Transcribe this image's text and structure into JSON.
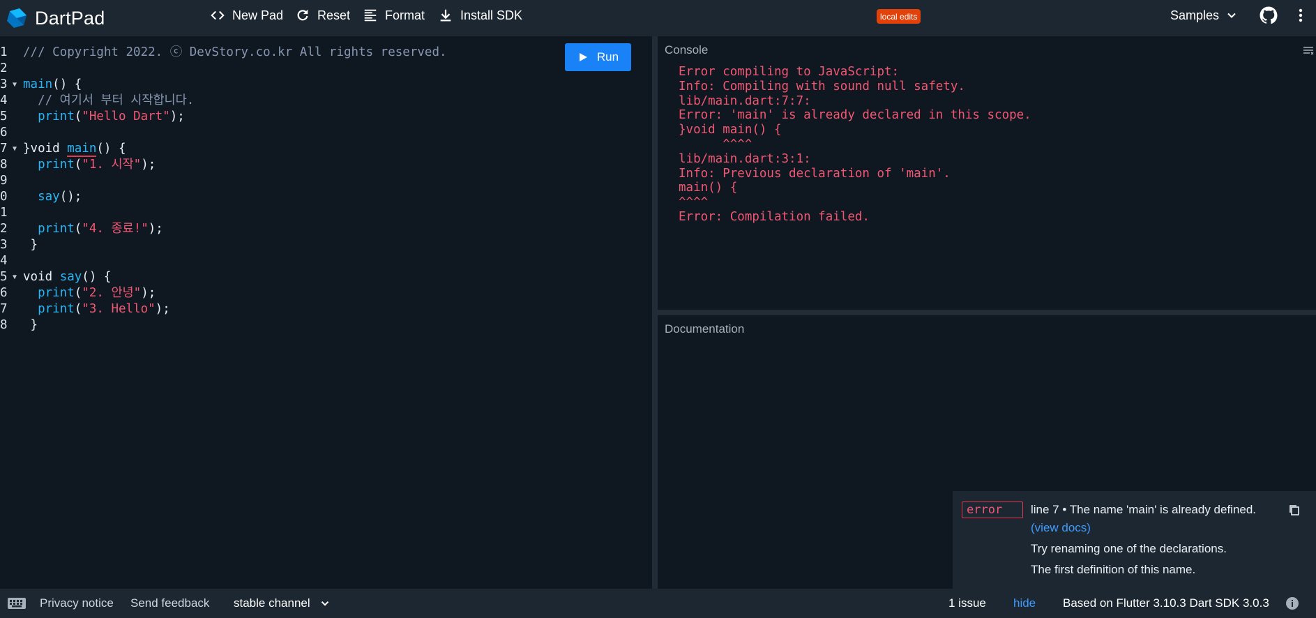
{
  "header": {
    "app_name": "DartPad",
    "new_pad": "New Pad",
    "reset": "Reset",
    "format": "Format",
    "install_sdk": "Install SDK",
    "badge": "local edits",
    "samples": "Samples",
    "accent": "#1a82f7",
    "badge_color": "#e2420a"
  },
  "editor": {
    "run_label": "Run",
    "lines": [
      {
        "n": "1",
        "fold": "",
        "parts": [
          [
            "c-comment",
            "/// Copyright 2022. ⓒ DevStory.co.kr All rights reserved."
          ]
        ]
      },
      {
        "n": "2",
        "fold": "",
        "parts": []
      },
      {
        "n": "3",
        "fold": "▼",
        "parts": [
          [
            "c-fn",
            "main"
          ],
          [
            "c-plain",
            "() {"
          ]
        ]
      },
      {
        "n": "4",
        "fold": "",
        "parts": [
          [
            "c-comment",
            "  // 여기서 부터 시작합니다."
          ]
        ]
      },
      {
        "n": "5",
        "fold": "",
        "parts": [
          [
            "c-fn",
            "  print"
          ],
          [
            "c-plain",
            "("
          ],
          [
            "c-str",
            "\"Hello Dart\""
          ],
          [
            "c-plain",
            ");"
          ]
        ]
      },
      {
        "n": "6",
        "fold": "",
        "parts": []
      },
      {
        "n": "7",
        "fold": "▼",
        "parts": [
          [
            "c-plain",
            "}void "
          ],
          [
            "c-err",
            "main"
          ],
          [
            "c-plain",
            "() {"
          ]
        ]
      },
      {
        "n": "8",
        "fold": "",
        "parts": [
          [
            "c-fn",
            "  print"
          ],
          [
            "c-plain",
            "("
          ],
          [
            "c-str",
            "\"1. 시작\""
          ],
          [
            "c-plain",
            ");"
          ]
        ]
      },
      {
        "n": "9",
        "fold": "",
        "parts": []
      },
      {
        "n": "0",
        "fold": "",
        "parts": [
          [
            "c-fn",
            "  say"
          ],
          [
            "c-plain",
            "();"
          ]
        ]
      },
      {
        "n": "1",
        "fold": "",
        "parts": []
      },
      {
        "n": "2",
        "fold": "",
        "parts": [
          [
            "c-fn",
            "  print"
          ],
          [
            "c-plain",
            "("
          ],
          [
            "c-str",
            "\"4. 종료!\""
          ],
          [
            "c-plain",
            ");"
          ]
        ]
      },
      {
        "n": "3",
        "fold": "",
        "parts": [
          [
            "c-plain",
            " }"
          ]
        ]
      },
      {
        "n": "4",
        "fold": "",
        "parts": []
      },
      {
        "n": "5",
        "fold": "▼",
        "parts": [
          [
            "c-plain",
            "void "
          ],
          [
            "c-fn",
            "say"
          ],
          [
            "c-plain",
            "() {"
          ]
        ]
      },
      {
        "n": "6",
        "fold": "",
        "parts": [
          [
            "c-fn",
            "  print"
          ],
          [
            "c-plain",
            "("
          ],
          [
            "c-str",
            "\"2. 안녕\""
          ],
          [
            "c-plain",
            ");"
          ]
        ]
      },
      {
        "n": "7",
        "fold": "",
        "parts": [
          [
            "c-fn",
            "  print"
          ],
          [
            "c-plain",
            "("
          ],
          [
            "c-str",
            "\"3. Hello\""
          ],
          [
            "c-plain",
            ");"
          ]
        ]
      },
      {
        "n": "8",
        "fold": "",
        "parts": [
          [
            "c-plain",
            " }"
          ]
        ]
      }
    ]
  },
  "console": {
    "title": "Console",
    "lines": [
      "Error compiling to JavaScript:",
      "Info: Compiling with sound null safety.",
      "lib/main.dart:7:7:",
      "Error: 'main' is already declared in this scope.",
      "}void main() {",
      "      ^^^^",
      "lib/main.dart:3:1:",
      "Info: Previous declaration of 'main'.",
      "main() {",
      "^^^^",
      "Error: Compilation failed."
    ]
  },
  "docs": {
    "title": "Documentation"
  },
  "issue": {
    "kind": "error",
    "message": "line 7 • The name 'main' is already defined.",
    "link": "(view docs)",
    "fix1": "Try renaming one of the declarations.",
    "fix2": "The first definition of this name."
  },
  "footer": {
    "privacy": "Privacy notice",
    "feedback": "Send feedback",
    "channel": "stable channel",
    "issues": "1 issue",
    "hide": "hide",
    "sdk": "Based on Flutter 3.10.3 Dart SDK 3.0.3"
  }
}
